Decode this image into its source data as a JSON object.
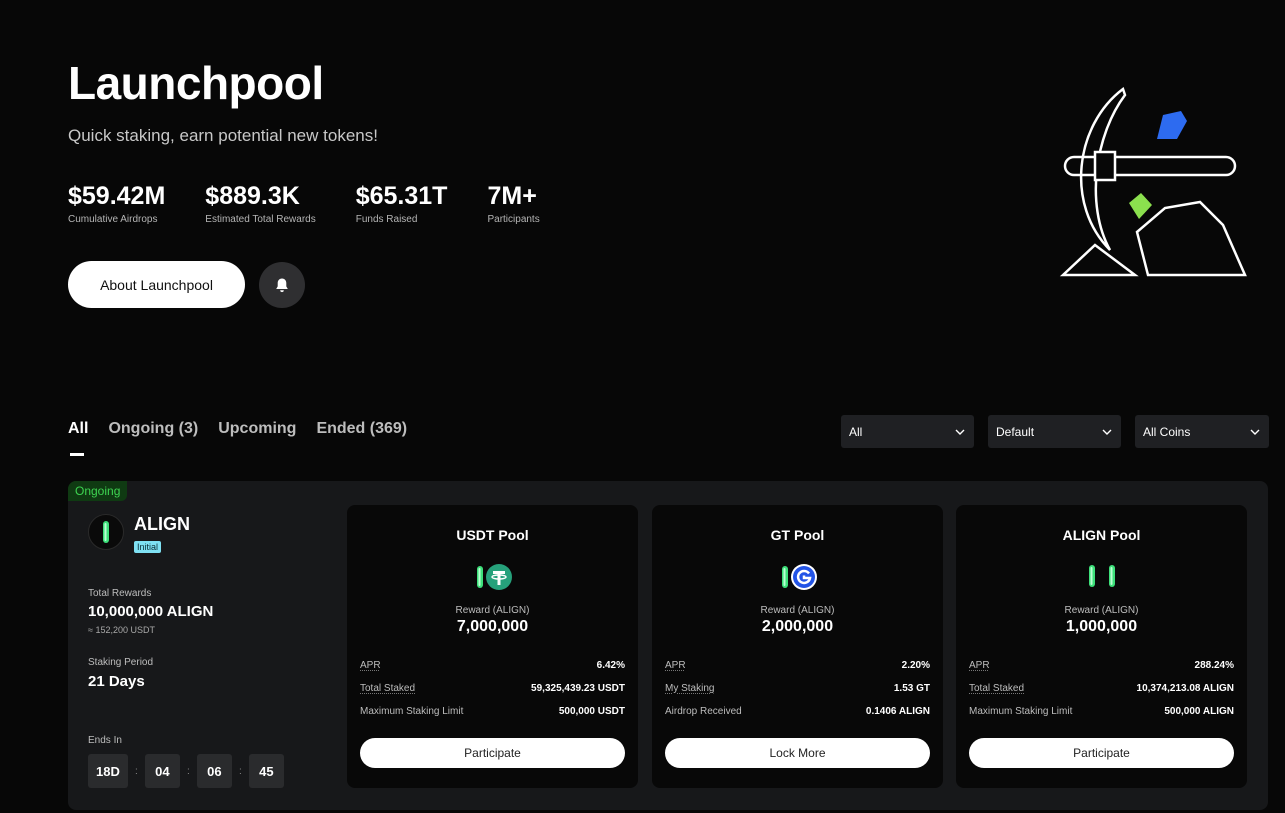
{
  "hero": {
    "title": "Launchpool",
    "subtitle": "Quick staking, earn potential new tokens!",
    "stats": [
      {
        "value": "$59.42M",
        "label": "Cumulative Airdrops"
      },
      {
        "value": "$889.3K",
        "label": "Estimated Total Rewards"
      },
      {
        "value": "$65.31T",
        "label": "Funds Raised"
      },
      {
        "value": "7M+",
        "label": "Participants"
      }
    ],
    "about_label": "About Launchpool"
  },
  "tabs": [
    {
      "label": "All"
    },
    {
      "label": "Ongoing (3)"
    },
    {
      "label": "Upcoming"
    },
    {
      "label": "Ended (369)"
    }
  ],
  "filters": [
    {
      "value": "All"
    },
    {
      "value": "Default"
    },
    {
      "value": "All Coins"
    }
  ],
  "project": {
    "status": "Ongoing",
    "token": "ALIGN",
    "badge": "Initial",
    "total_rewards_label": "Total Rewards",
    "total_rewards": "10,000,000 ALIGN",
    "total_rewards_usd": "≈ 152,200 USDT",
    "staking_period_label": "Staking Period",
    "staking_period": "21 Days",
    "ends_in_label": "Ends In",
    "countdown": {
      "d": "18D",
      "h": "04",
      "m": "06",
      "s": "45"
    }
  },
  "pools": [
    {
      "title": "USDT Pool",
      "reward_label": "Reward (ALIGN)",
      "reward": "7,000,000",
      "rows": [
        {
          "k": "APR",
          "v": "6.42%"
        },
        {
          "k": "Total Staked",
          "v": "59,325,439.23 USDT"
        },
        {
          "k": "Maximum Staking Limit",
          "v": "500,000 USDT"
        }
      ],
      "button": "Participate"
    },
    {
      "title": "GT Pool",
      "reward_label": "Reward (ALIGN)",
      "reward": "2,000,000",
      "rows": [
        {
          "k": "APR",
          "v": "2.20%"
        },
        {
          "k": "My Staking",
          "v": "1.53 GT"
        },
        {
          "k": "Airdrop Received",
          "v": "0.1406 ALIGN"
        }
      ],
      "button": "Lock More"
    },
    {
      "title": "ALIGN Pool",
      "reward_label": "Reward (ALIGN)",
      "reward": "1,000,000",
      "rows": [
        {
          "k": "APR",
          "v": "288.24%"
        },
        {
          "k": "Total Staked",
          "v": "10,374,213.08 ALIGN"
        },
        {
          "k": "Maximum Staking Limit",
          "v": "500,000 ALIGN"
        }
      ],
      "button": "Participate"
    }
  ],
  "colors": {
    "background": "#070707",
    "card": "#17181a",
    "pool_card": "#080808",
    "ongoing_green": "#3ed451",
    "initial_badge": "#7fe1f3",
    "gt_blue": "#2354e6",
    "usdt_green": "#26a17b",
    "illus_blue": "#2d6bf0",
    "illus_green": "#8be04e"
  },
  "icons": {
    "bell": "bell-icon",
    "chevron": "chevron-down-icon",
    "align": "align-token-icon",
    "usdt": "usdt-token-icon",
    "gt": "gt-token-icon"
  }
}
